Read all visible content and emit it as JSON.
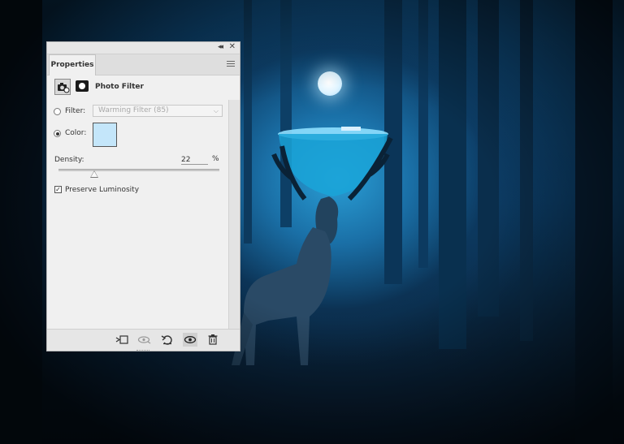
{
  "panel": {
    "tab_label": "Properties",
    "title": "Photo Filter",
    "filter_label": "Filter:",
    "filter_value": "Warming Filter (85)",
    "color_label": "Color:",
    "color_swatch": "#c4e6fa",
    "density_label": "Density:",
    "density_value": "22",
    "density_unit": "%",
    "density_fraction": 0.22,
    "preserve_label": "Preserve Luminosity",
    "preserve_checked": true,
    "selected_mode": "color"
  },
  "icons": {
    "collapse": "double-chevron-left-icon",
    "close": "close-icon",
    "menu": "panel-menu-icon",
    "adjustment": "camera-filter-adjustment-icon",
    "mask": "layer-mask-icon",
    "clip": "clip-to-layer-icon",
    "view_previous": "view-previous-state-icon",
    "reset": "reset-icon",
    "visibility": "eye-icon",
    "delete": "trash-icon"
  }
}
